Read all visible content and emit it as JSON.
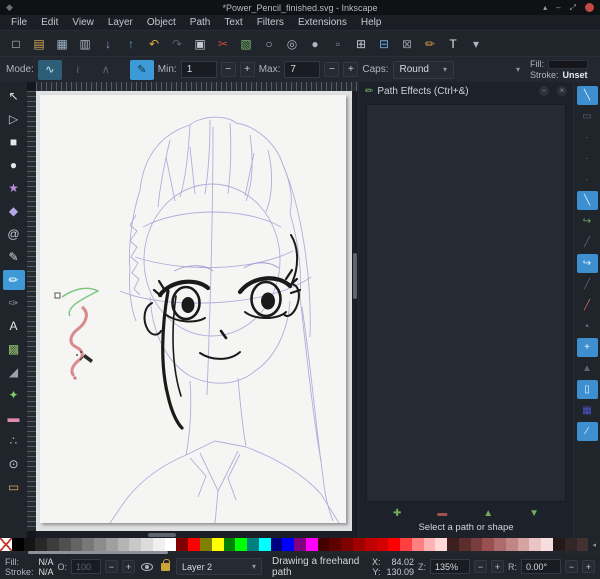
{
  "window": {
    "title": "*Power_Pencil_finished.svg - Inkscape",
    "app_icon": "◆",
    "pin": "▴",
    "minimize": "–",
    "maximize": "⤢"
  },
  "menubar": {
    "items": [
      "File",
      "Edit",
      "View",
      "Layer",
      "Object",
      "Path",
      "Text",
      "Filters",
      "Extensions",
      "Help"
    ]
  },
  "command_toolbar": {
    "buttons": [
      {
        "name": "new-document-button",
        "glyph": "□",
        "color": "#d9dde2"
      },
      {
        "name": "open-document-button",
        "glyph": "▤",
        "color": "#d8a85c"
      },
      {
        "name": "save-button",
        "glyph": "▦",
        "color": "#9fb6c9"
      },
      {
        "name": "print-button",
        "glyph": "▥",
        "color": "#aeb6bf"
      },
      {
        "name": "import-button",
        "glyph": "↓",
        "color": "#b07fd8"
      },
      {
        "name": "export-button",
        "glyph": "↑",
        "color": "#5d9fd4"
      },
      {
        "name": "undo-button",
        "glyph": "↶",
        "color": "#e0a93e"
      },
      {
        "name": "redo-button",
        "glyph": "↷",
        "color": "#59606b"
      },
      {
        "name": "copy-button",
        "glyph": "▣",
        "color": "#c3cad2"
      },
      {
        "name": "cut-button",
        "glyph": "✂",
        "color": "#cc4b3b"
      },
      {
        "name": "paste-button",
        "glyph": "▧",
        "color": "#79b569"
      },
      {
        "name": "zoom-selection-button",
        "glyph": "○",
        "color": "#aeb5bd"
      },
      {
        "name": "zoom-drawing-button",
        "glyph": "◎",
        "color": "#aeb5bd"
      },
      {
        "name": "zoom-page-button",
        "glyph": "●",
        "color": "#aeb5bd"
      },
      {
        "name": "zoom-width-button",
        "glyph": "▫",
        "color": "#8d939b"
      },
      {
        "name": "duplicate-button",
        "glyph": "⊞",
        "color": "#c3cad2"
      },
      {
        "name": "clone-button",
        "glyph": "⊟",
        "color": "#6fa6d8"
      },
      {
        "name": "unlink-clone-button",
        "glyph": "⊠",
        "color": "#8d939b"
      },
      {
        "name": "fill-stroke-dialog-button",
        "glyph": "✏",
        "color": "#d79b4a"
      },
      {
        "name": "text-dialog-button",
        "glyph": "T",
        "color": "#e4e7eb"
      },
      {
        "name": "toolbar-overflow-button",
        "glyph": "▾",
        "color": "#aeb5bd"
      }
    ]
  },
  "tool_options": {
    "mode_label": "Mode:",
    "modes": [
      {
        "glyph": "∿"
      },
      {
        "glyph": "≀"
      },
      {
        "glyph": "∧"
      }
    ],
    "pressure_glyph": "✎",
    "min_label": "Min:",
    "min_value": "1",
    "max_label": "Max:",
    "max_value": "7",
    "caps_label": "Caps:",
    "caps_value": "Round",
    "minus": "−",
    "plus": "+",
    "overflow": "▾",
    "fill_label": "Fill:",
    "stroke_label": "Stroke:",
    "stroke_value": "Unset"
  },
  "toolbox": {
    "tools": [
      {
        "name": "tool-selector",
        "glyph": "↖",
        "color": "#e4e6e9"
      },
      {
        "name": "tool-node-editor",
        "glyph": "▷",
        "color": "#c3cad2"
      },
      {
        "name": "tool-rectangle",
        "glyph": "■",
        "color": "#e4e6e9"
      },
      {
        "name": "tool-ellipse",
        "glyph": "●",
        "color": "#e4e6e9"
      },
      {
        "name": "tool-star",
        "glyph": "★",
        "color": "#b98fd9"
      },
      {
        "name": "tool-3dbox",
        "glyph": "◆",
        "color": "#b4a6e3"
      },
      {
        "name": "tool-spiral",
        "glyph": "@",
        "color": "#c5cad2"
      },
      {
        "name": "tool-pen-bezier",
        "glyph": "✎",
        "color": "#d5d9df"
      },
      {
        "name": "tool-pencil-freehand",
        "glyph": "✏",
        "active": true
      },
      {
        "name": "tool-calligraphy",
        "glyph": "✑",
        "color": "#8a9099"
      },
      {
        "name": "tool-text",
        "glyph": "A",
        "color": "#e2e5e9"
      },
      {
        "name": "tool-spray",
        "glyph": "▩",
        "color": "#8fbf6f"
      },
      {
        "name": "tool-tweak",
        "glyph": "◢",
        "color": "#9aa1aa"
      },
      {
        "name": "tool-dropper",
        "glyph": "✦",
        "color": "#7fc96b"
      },
      {
        "name": "tool-eraser",
        "glyph": "▬",
        "color": "#e08ab0"
      },
      {
        "name": "tool-connector",
        "glyph": "∴",
        "color": "#aeb5bd"
      },
      {
        "name": "tool-zoom",
        "glyph": "⊙",
        "color": "#c9ced6"
      },
      {
        "name": "tool-measure",
        "glyph": "▭",
        "color": "#dba35f"
      }
    ]
  },
  "snapbar": {
    "buttons": [
      {
        "name": "snap-master-toggle",
        "glyph": "╲",
        "active": true
      },
      {
        "name": "snap-bounding-box",
        "glyph": "▭",
        "active": false
      },
      {
        "name": "snap-bbox-edges",
        "glyph": "·",
        "active": false
      },
      {
        "name": "snap-bbox-corners",
        "glyph": "·",
        "active": false
      },
      {
        "name": "snap-bbox-midpoints",
        "glyph": "·",
        "active": false
      },
      {
        "name": "snap-nodes",
        "glyph": "╲",
        "active": true
      },
      {
        "name": "snap-paths",
        "glyph": "↪",
        "active": false,
        "color": "#6fae5a"
      },
      {
        "name": "snap-path-intersections",
        "glyph": "╱",
        "active": false
      },
      {
        "name": "snap-cusp-nodes",
        "glyph": "↪",
        "active": true
      },
      {
        "name": "snap-smooth-nodes",
        "glyph": "╱",
        "active": false
      },
      {
        "name": "snap-line-midpoints",
        "glyph": "╱",
        "active": false,
        "color": "#c96a55"
      },
      {
        "name": "snap-object-midpoints",
        "glyph": "▪",
        "active": false
      },
      {
        "name": "snap-object-centers",
        "glyph": "+",
        "active": true
      },
      {
        "name": "snap-rotation-centers",
        "glyph": "▲",
        "active": false
      },
      {
        "name": "snap-page-border",
        "glyph": "▯",
        "active": true
      },
      {
        "name": "snap-grid",
        "glyph": "▦",
        "active": false,
        "color": "#4a55d0"
      },
      {
        "name": "snap-guides",
        "glyph": "∕",
        "active": true
      }
    ]
  },
  "path_effects_panel": {
    "icon": "✏",
    "title": "Path Effects (Ctrl+&)",
    "iconify": "−",
    "close": "×",
    "add_label": "✚",
    "remove_label": "▬",
    "up_label": "▲",
    "down_label": "▼",
    "status": "Select a path or shape"
  },
  "palette": {
    "scroll_arrow": "◂",
    "colors": [
      "none",
      "#000000",
      "#141414",
      "#282828",
      "#3c3c3c",
      "#505050",
      "#646464",
      "#787878",
      "#8c8c8c",
      "#a0a0a0",
      "#b4b4b4",
      "#c8c8c8",
      "#dcdcdc",
      "#f0f0f0",
      "#ffffff",
      "#800000",
      "#ff0000",
      "#808000",
      "#ffff00",
      "#008000",
      "#00ff00",
      "#008080",
      "#00ffff",
      "#000080",
      "#0000ff",
      "#800080",
      "#ff00ff",
      "#450000",
      "#5f0000",
      "#800000",
      "#a00000",
      "#bf0000",
      "#d40000",
      "#ff0000",
      "#ff4040",
      "#ff8080",
      "#ffb3b3",
      "#ffd9d9",
      "#3d1f1f",
      "#5c2e2e",
      "#7a3d3d",
      "#995050",
      "#ad6b6b",
      "#c28585",
      "#d6a3a3",
      "#ebc4c4",
      "#f7dede",
      "#241a1a",
      "#332626",
      "#423232"
    ]
  },
  "statusbar": {
    "fill_label": "Fill:",
    "fill_value": "N/A",
    "stroke_label": "Stroke:",
    "stroke_value": "N/A",
    "opacity_label": "O:",
    "opacity_value": "100",
    "minus": "−",
    "plus": "+",
    "layer_value": "Layer 2",
    "dd_arrow": "▾",
    "message": "Drawing a freehand path",
    "x_label": "X:",
    "x_value": "84.02",
    "y_label": "Y:",
    "y_value": "130.09",
    "zoom_label": "Z:",
    "zoom_value": "135%",
    "rotation_label": "R:",
    "rotation_value": "0.00°"
  }
}
